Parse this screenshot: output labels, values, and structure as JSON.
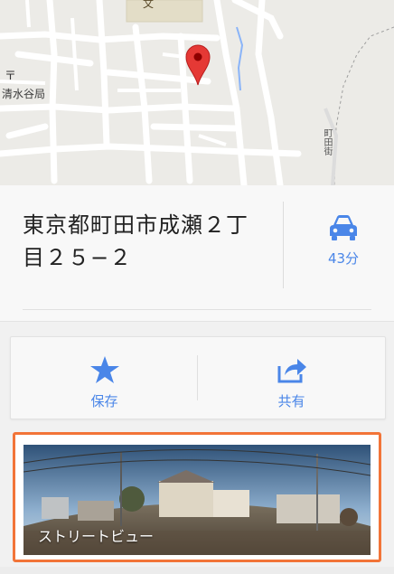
{
  "map": {
    "labels": {
      "post_office": "清水谷局",
      "road": "町田街"
    }
  },
  "place": {
    "address": "東京都町田市成瀬２丁目２５−２",
    "drive_time": "43分"
  },
  "actions": {
    "save_label": "保存",
    "share_label": "共有"
  },
  "street_view": {
    "label": "ストリートビュー"
  },
  "colors": {
    "accent": "#4a86e8",
    "highlight_border": "#f27438",
    "pin": "#e53935"
  }
}
